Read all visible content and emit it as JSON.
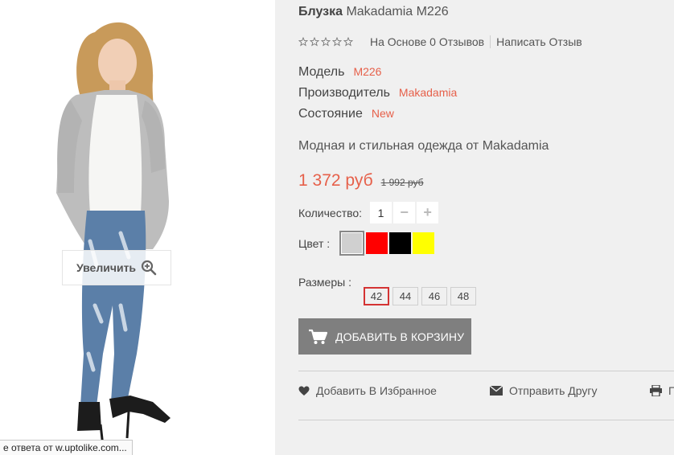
{
  "image": {
    "zoom_label": "Увеличить",
    "status_tip": "е ответа от w.uptolike.com..."
  },
  "product": {
    "title_brand": "Блузка",
    "title_sub": "Makadamia M226",
    "rating": {
      "stars": 0,
      "max_stars": 5,
      "reviews_label": "На Основе 0 Отзывов",
      "write_review_label": "Написать Отзыв"
    },
    "specs": [
      {
        "label": "Модель",
        "value": "M226"
      },
      {
        "label": "Производитель",
        "value": "Makadamia"
      },
      {
        "label": "Состояние",
        "value": "New"
      }
    ],
    "description": "Модная и стильная одежда от Makadamia",
    "price_new": "1 372 руб",
    "price_old": "1 992 руб",
    "quantity": {
      "label": "Количество:",
      "value": "1",
      "minus": "−",
      "plus": "+"
    },
    "colors": {
      "label": "Цвет :",
      "options": [
        "#d0d0d0",
        "#ff0000",
        "#000000",
        "#ffff00"
      ],
      "selected_index": 0
    },
    "sizes": {
      "label": "Размеры :",
      "options": [
        "42",
        "44",
        "46",
        "48"
      ],
      "selected_index": 0
    },
    "add_to_cart": "ДОБАВИТЬ В КОРЗИНУ"
  },
  "actions": {
    "wishlist": "Добавить В Избранное",
    "send_friend": "Отправить Другу",
    "print": "П"
  },
  "theme": {
    "accent": "#e6604a",
    "button": "#7f7f7f",
    "selected_size_border": "#d43333"
  }
}
